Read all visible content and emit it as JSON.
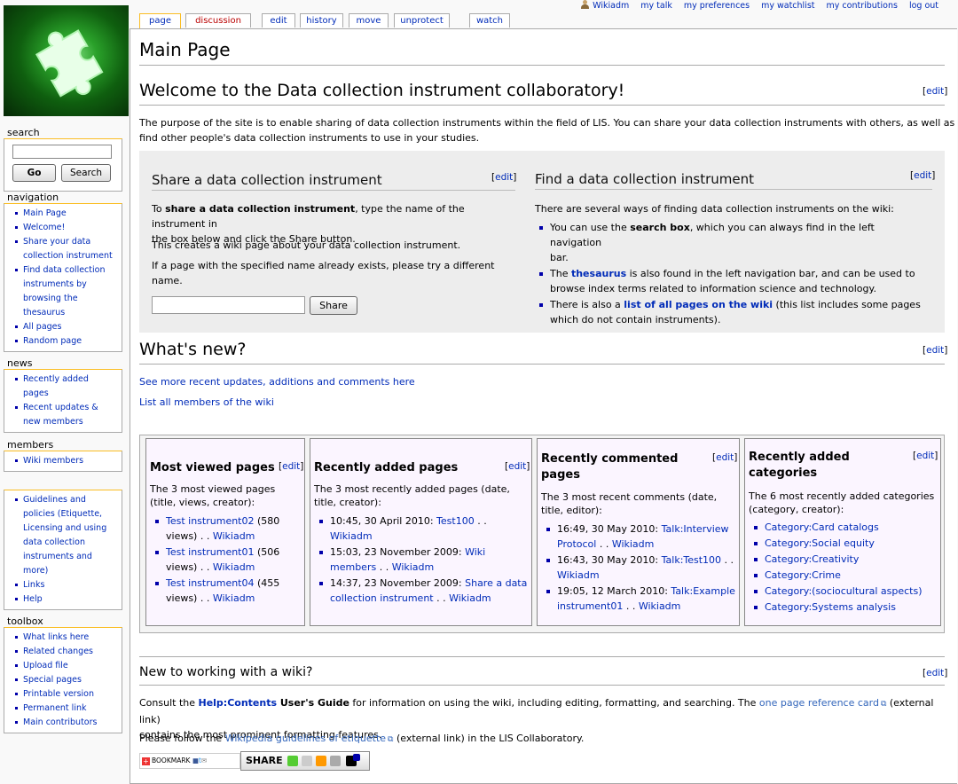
{
  "personal": {
    "username": "Wikiadm",
    "talk": "my talk",
    "preferences": "my preferences",
    "watchlist": "my watchlist",
    "contributions": "my contributions",
    "logout": "log out"
  },
  "tabs": [
    "page",
    "discussion",
    "edit",
    "history",
    "move",
    "unprotect",
    "watch"
  ],
  "sidebar": {
    "search": {
      "heading": "search",
      "go": "Go",
      "search": "Search"
    },
    "navigation": {
      "heading": "navigation",
      "items": [
        "Main Page",
        "Welcome!",
        "Share your data",
        "collection instrument",
        "Find data collection",
        "instruments by",
        "browsing the",
        "thesaurus",
        "All pages",
        "Random page"
      ]
    },
    "news": {
      "heading": "news",
      "items": [
        "Recently added",
        "pages",
        "Recent updates &",
        "new members"
      ]
    },
    "members": {
      "heading": "members",
      "items": [
        "Wiki members"
      ]
    },
    "extra": {
      "items": [
        "Guidelines and",
        "policies (Etiquette,",
        "Licensing and using",
        "data collection",
        "instruments and",
        "more)",
        "Links",
        "Help"
      ]
    },
    "toolbox": {
      "heading": "toolbox",
      "items": [
        "What links here",
        "Related changes",
        "Upload file",
        "Special pages",
        "Printable version",
        "Permanent link",
        "Main contributors"
      ]
    }
  },
  "page": {
    "title": "Main Page",
    "edit": "edit",
    "welcome": {
      "heading": "Welcome to the Data collection instrument collaboratory!",
      "text1": "The purpose of the site is to enable sharing of data collection instruments within the field of LIS. You can share your data collection instruments with others, as well as",
      "text2": "find other people's data collection instruments to use in your studies."
    },
    "share": {
      "heading": "Share a data collection instrument",
      "p1a": "To ",
      "p1b": "share a data collection instrument",
      "p1c": ", type the name of the instrument in",
      "p1d": "the box below and click the Share button.",
      "p2": "This creates a wiki page about your data collection instrument.",
      "p3a": "If a page with the specified name already exists, please try a different",
      "p3b": "name.",
      "button": "Share"
    },
    "find": {
      "heading": "Find a data collection instrument",
      "intro": "There are several ways of finding data collection instruments on the wiki:",
      "i1a": "You can use the ",
      "i1b": "search box",
      "i1c": ", which you can always find in the left navigation",
      "i1d": "bar.",
      "i2a": "The ",
      "i2b": "thesaurus",
      "i2c": " is also found in the left navigation bar, and can be used to",
      "i2d": "browse index terms related to information science and technology.",
      "i3a": "There is also a ",
      "i3b": "list of all pages on the wiki",
      "i3c": " (this list includes some pages",
      "i3d": "which do not contain instruments)."
    },
    "whatsnew": {
      "heading": "What's new?",
      "link1": "See more recent updates, additions and comments here",
      "link2": "List all members of the wiki"
    },
    "boxes": {
      "viewed": {
        "title": "Most viewed pages",
        "desc1": "The 3 most viewed pages",
        "desc2": "(title, views, creator):",
        "items": [
          {
            "a": "Test instrument02",
            "b": " (580",
            "c": "views) . . ",
            "d": "Wikiadm"
          },
          {
            "a": "Test instrument01",
            "b": " (506",
            "c": "views) . . ",
            "d": "Wikiadm"
          },
          {
            "a": "Test instrument04",
            "b": " (455",
            "c": "views) . . ",
            "d": "Wikiadm"
          }
        ]
      },
      "added": {
        "title": "Recently added pages",
        "desc1": "The 3 most recently added pages (date,",
        "desc2": "title, creator):",
        "items": [
          {
            "a": "10:45, 30 April 2010: ",
            "b": "Test100",
            "c": " . .",
            "d": "Wikiadm"
          },
          {
            "a": "15:03, 23 November 2009: ",
            "b": "Wiki",
            "c": "members",
            "d": " . . ",
            "e": "Wikiadm"
          },
          {
            "a": "14:37, 23 November 2009: ",
            "b": "Share a data",
            "c": "collection instrument",
            "d": " . . ",
            "e": "Wikiadm"
          }
        ]
      },
      "commented": {
        "title1": "Recently commented",
        "title2": "pages",
        "desc1": "The 3 most recent comments (date,",
        "desc2": "title, editor):",
        "items": [
          {
            "a": "16:49, 30 May 2010: ",
            "b": "Talk:Interview",
            "c": "Protocol",
            "d": " . . ",
            "e": "Wikiadm"
          },
          {
            "a": "16:43, 30 May 2010: ",
            "b": "Talk:Test100",
            "c": " . .",
            "d": "Wikiadm"
          },
          {
            "a": "19:05, 12 March 2010: ",
            "b": "Talk:Example",
            "c": "instrument01",
            "d": " . . ",
            "e": "Wikiadm"
          }
        ]
      },
      "categories": {
        "title1": "Recently added",
        "title2": "categories",
        "desc1": "The 6 most recently added categories",
        "desc2": "(category, creator):",
        "items": [
          "Category:Card catalogs",
          "Category:Social equity",
          "Category:Creativity",
          "Category:Crime",
          "Category:(sociocultural aspects)",
          "Category:Systems analysis"
        ]
      }
    },
    "newwiki": {
      "heading": "New to working with a wiki?",
      "p1a": "Consult the ",
      "p1b": "Help:Contents",
      "p1c": " User's Guide",
      "p1d": " for information on using the wiki, including editing, formatting, and searching. The ",
      "p1e": "one page reference card",
      "p1f": " (external link)",
      "p1g": "contains the most prominent formatting features.",
      "p2a": "Please follow the ",
      "p2b": "Wikipedia guidelines of etiquette",
      "p2c": " (external link) in the LIS Collaboratory."
    },
    "bookmark": "BOOKMARK",
    "share_bar": "SHARE"
  },
  "colors": {
    "link": "#002bb8",
    "new_link": "#ba0000",
    "tab_selected": "#fabd23",
    "logo": "#1f8f1f"
  }
}
